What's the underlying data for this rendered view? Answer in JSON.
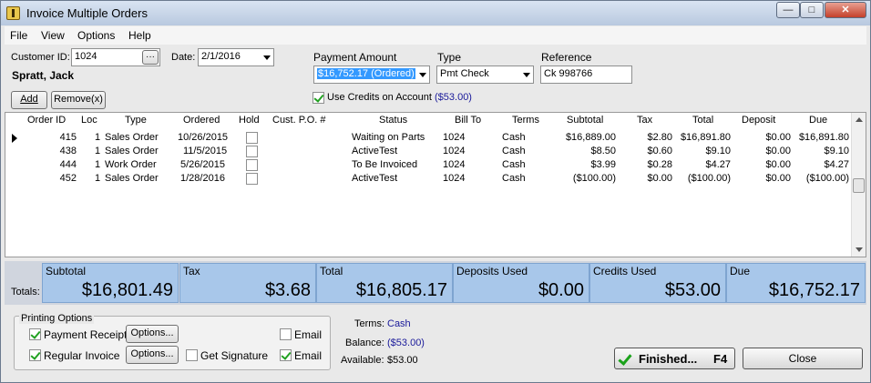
{
  "window": {
    "title": "Invoice Multiple Orders",
    "min_glyph": "—",
    "max_glyph": "□",
    "close_glyph": "✕"
  },
  "menu": [
    "File",
    "View",
    "Options",
    "Help"
  ],
  "customer": {
    "id_label": "Customer ID:",
    "id_value": "1024",
    "ellipsis": "···",
    "name": "Spratt, Jack"
  },
  "date": {
    "label": "Date:",
    "value": "2/1/2016"
  },
  "payment": {
    "amount_label": "Payment Amount",
    "amount_value": "$16,752.17  (Ordered)",
    "type_label": "Type",
    "type_value": "Pmt Check",
    "reference_label": "Reference",
    "reference_value": "Ck 998766",
    "use_credits_label": "Use Credits on Account",
    "use_credits_checked": true,
    "credits_amount": "($53.00)"
  },
  "buttons": {
    "add": "Add",
    "remove": "Remove(x)",
    "finished": "Finished...",
    "finished_key": "F4",
    "close": "Close",
    "options": "Options..."
  },
  "grid": {
    "columns": [
      "Order ID",
      "Loc",
      "Type",
      "Ordered",
      "Hold",
      "Cust. P.O. #",
      "Status",
      "Bill To",
      "Terms",
      "Subtotal",
      "Tax",
      "Total",
      "Deposit",
      "Due"
    ],
    "rows": [
      {
        "order_id": "415",
        "loc": "1",
        "type": "Sales Order",
        "ordered": "10/26/2015",
        "hold": false,
        "po": "",
        "status": "Waiting on Parts",
        "bill_to": "1024",
        "terms": "Cash",
        "subtotal": "$16,889.00",
        "tax": "$2.80",
        "total": "$16,891.80",
        "deposit": "$0.00",
        "due": "$16,891.80"
      },
      {
        "order_id": "438",
        "loc": "1",
        "type": "Sales Order",
        "ordered": "11/5/2015",
        "hold": false,
        "po": "",
        "status": "ActiveTest",
        "bill_to": "1024",
        "terms": "Cash",
        "subtotal": "$8.50",
        "tax": "$0.60",
        "total": "$9.10",
        "deposit": "$0.00",
        "due": "$9.10"
      },
      {
        "order_id": "444",
        "loc": "1",
        "type": "Work Order",
        "ordered": "5/26/2015",
        "hold": false,
        "po": "",
        "status": "To Be Invoiced",
        "bill_to": "1024",
        "terms": "Cash",
        "subtotal": "$3.99",
        "tax": "$0.28",
        "total": "$4.27",
        "deposit": "$0.00",
        "due": "$4.27"
      },
      {
        "order_id": "452",
        "loc": "1",
        "type": "Sales Order",
        "ordered": "1/28/2016",
        "hold": false,
        "po": "",
        "status": "ActiveTest",
        "bill_to": "1024",
        "terms": "Cash",
        "subtotal": "($100.00)",
        "tax": "$0.00",
        "total": "($100.00)",
        "deposit": "$0.00",
        "due": "($100.00)"
      }
    ]
  },
  "totals": {
    "label": "Totals:",
    "subtotal_label": "Subtotal",
    "subtotal": "$16,801.49",
    "tax_label": "Tax",
    "tax": "$3.68",
    "total_label": "Total",
    "total": "$16,805.17",
    "deposits_label": "Deposits Used",
    "deposits": "$0.00",
    "credits_label": "Credits Used",
    "credits": "$53.00",
    "due_label": "Due",
    "due": "$16,752.17"
  },
  "printing": {
    "legend": "Printing Options",
    "payment_receipt_label": "Payment Receipt",
    "payment_receipt_checked": true,
    "regular_invoice_label": "Regular Invoice",
    "regular_invoice_checked": true,
    "get_signature_label": "Get Signature",
    "get_signature_checked": false,
    "email_label": "Email",
    "email1_checked": false,
    "email2_checked": true
  },
  "summary": {
    "terms_label": "Terms:",
    "terms_value": "Cash",
    "balance_label": "Balance:",
    "balance_value": "($53.00)",
    "available_label": "Available:",
    "available_value": "$53.00"
  }
}
